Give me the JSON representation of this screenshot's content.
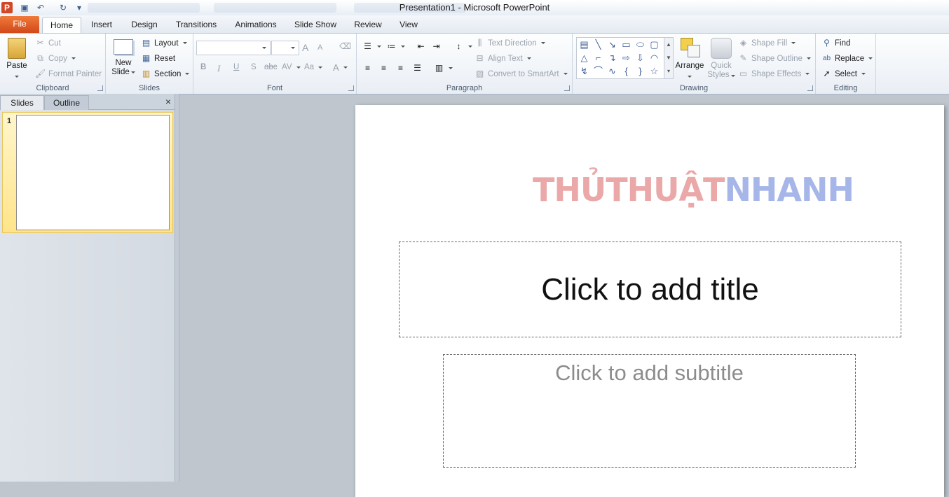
{
  "titlebar": {
    "title": "Presentation1  -  Microsoft PowerPoint",
    "app_icon": "P",
    "quick_access": [
      "save-icon",
      "undo-icon",
      "redo-icon",
      "customize-icon"
    ]
  },
  "tabs": [
    {
      "label": "File"
    },
    {
      "label": "Home"
    },
    {
      "label": "Insert"
    },
    {
      "label": "Design"
    },
    {
      "label": "Transitions"
    },
    {
      "label": "Animations"
    },
    {
      "label": "Slide Show"
    },
    {
      "label": "Review"
    },
    {
      "label": "View"
    }
  ],
  "ribbon": {
    "clipboard": {
      "label": "Clipboard",
      "paste": "Paste",
      "cut": "Cut",
      "copy": "Copy",
      "format_painter": "Format Painter"
    },
    "slides": {
      "label": "Slides",
      "new_slide_1": "New",
      "new_slide_2": "Slide",
      "layout": "Layout",
      "reset": "Reset",
      "section": "Section"
    },
    "font": {
      "label": "Font",
      "grow": "A",
      "shrink": "A",
      "bold": "B",
      "italic": "I",
      "underline": "U",
      "shadow": "S",
      "strike": "abc",
      "spacing": "AV",
      "case": "Aa",
      "color": "A"
    },
    "paragraph": {
      "label": "Paragraph",
      "text_direction": "Text Direction",
      "align_text": "Align Text",
      "convert_smartart": "Convert to SmartArt"
    },
    "drawing": {
      "label": "Drawing",
      "arrange": "Arrange",
      "quick_styles_1": "Quick",
      "quick_styles_2": "Styles",
      "shape_fill": "Shape Fill",
      "shape_outline": "Shape Outline",
      "shape_effects": "Shape Effects"
    },
    "editing": {
      "label": "Editing",
      "find": "Find",
      "replace": "Replace",
      "select": "Select"
    }
  },
  "left_pane": {
    "tabs": [
      "Slides",
      "Outline"
    ],
    "close": "×",
    "thumbnail_number": "1"
  },
  "slide": {
    "logo_part1": "THỦTHUẬT",
    "logo_part2": "NHANH",
    "title_placeholder": "Click to add title",
    "subtitle_placeholder": "Click to add subtitle"
  },
  "colors": {
    "file_tab": "#d2481a",
    "logo_red": "#eaa8a8",
    "logo_blue": "#a6b6e8",
    "selected_thumb": "#ffe48a"
  }
}
